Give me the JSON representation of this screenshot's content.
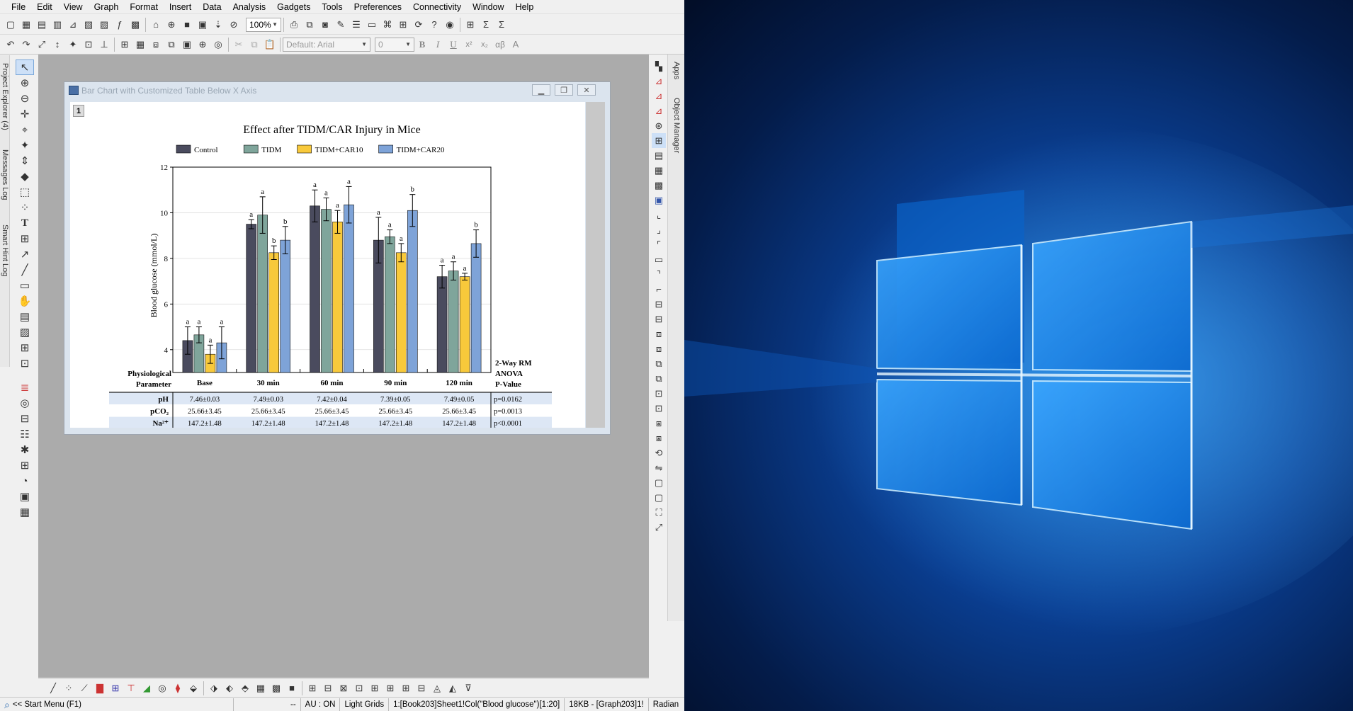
{
  "menu": [
    "File",
    "Edit",
    "View",
    "Graph",
    "Format",
    "Insert",
    "Data",
    "Analysis",
    "Gadgets",
    "Tools",
    "Preferences",
    "Connectivity",
    "Window",
    "Help"
  ],
  "toolbar": {
    "zoom": "100%",
    "font": "Default: Arial",
    "font_size": "0",
    "bold": "B",
    "italic": "I",
    "underline": "U",
    "superscript": "x²",
    "subscript": "x₂",
    "greek": "αβ",
    "text_size": "A"
  },
  "left_tabs": {
    "project_explorer": "Project Explorer (4)",
    "messages_log": "Messages Log",
    "smart_hint_log": "Smart Hint Log"
  },
  "right_tabs": {
    "apps": "Apps",
    "object_manager": "Object Manager"
  },
  "graph_window": {
    "title": "Bar Chart with Customized Table Below X Axis",
    "layer": "1"
  },
  "chart_data": {
    "type": "bar",
    "title": "Effect after TIDM/CAR Injury in Mice",
    "ylabel": "Blood glucose (mmol/L)",
    "ylim": [
      3,
      12
    ],
    "yticks": [
      "4",
      "6",
      "8",
      "10",
      "12"
    ],
    "categories": [
      "Base",
      "30 min",
      "60 min",
      "90 min",
      "120 min"
    ],
    "series": [
      {
        "name": "Control",
        "color": "#4a4b5e",
        "values": [
          4.4,
          9.5,
          10.3,
          8.8,
          7.2
        ],
        "errors": [
          0.6,
          0.2,
          0.7,
          1.0,
          0.5
        ],
        "labels": [
          "a",
          "a",
          "a",
          "a",
          "a"
        ]
      },
      {
        "name": "TIDM",
        "color": "#7fa59b",
        "values": [
          4.65,
          9.9,
          10.15,
          8.95,
          7.45
        ],
        "errors": [
          0.35,
          0.8,
          0.5,
          0.3,
          0.4
        ],
        "labels": [
          "a",
          "a",
          "a",
          "a",
          "a"
        ]
      },
      {
        "name": "TIDM+CAR10",
        "color": "#f8c93b",
        "values": [
          3.8,
          8.25,
          9.6,
          8.25,
          7.2
        ],
        "errors": [
          0.4,
          0.3,
          0.5,
          0.4,
          0.15
        ],
        "labels": [
          "a",
          "b",
          "a",
          "a",
          "a"
        ]
      },
      {
        "name": "TIDM+CAR20",
        "color": "#7ea3d8",
        "values": [
          4.3,
          8.8,
          10.35,
          10.1,
          8.65
        ],
        "errors": [
          0.7,
          0.6,
          0.8,
          0.7,
          0.6
        ],
        "labels": [
          "a",
          "b",
          "a",
          "b",
          "b"
        ]
      }
    ],
    "legend_position": "top",
    "table": {
      "header_first": "Physiological\nParameter",
      "header_last": "2-Way RM\nANOVA\nP-Value",
      "rows": [
        {
          "param": "pH",
          "values": [
            "7.46±0.03",
            "7.49±0.03",
            "7.42±0.04",
            "7.39±0.05",
            "7.49±0.05"
          ],
          "pvalue": "p=0.0162"
        },
        {
          "param": "pCO₂",
          "values": [
            "25.66±3.45",
            "25.66±3.45",
            "25.66±3.45",
            "25.66±3.45",
            "25.66±3.45"
          ],
          "pvalue": "p=0.0013"
        },
        {
          "param": "Na²⁺",
          "values": [
            "147.2±1.48",
            "147.2±1.48",
            "147.2±1.48",
            "147.2±1.48",
            "147.2±1.48"
          ],
          "pvalue": "p<0.0001"
        }
      ]
    }
  },
  "status": {
    "start_menu": "<< Start Menu (F1)",
    "dashes": "--",
    "au": "AU : ON",
    "grids": "Light Grids",
    "data_ref": "1:[Book203]Sheet1!Col(\"Blood glucose\")[1:20]",
    "size": "18KB - [Graph203]1!",
    "units": "Radian"
  }
}
